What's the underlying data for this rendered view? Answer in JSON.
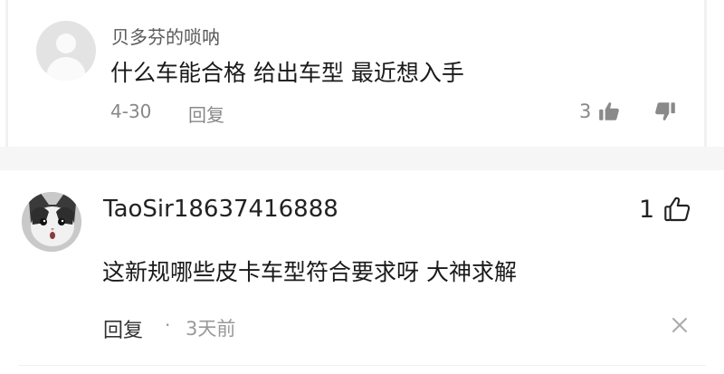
{
  "comments": [
    {
      "username": "贝多芬的唢呐",
      "text": "什么车能合格 给出车型 最近想入手",
      "date": "4-30",
      "reply_label": "回复",
      "likes": "3"
    },
    {
      "username": "TaoSir18637416888",
      "text": "这新规哪些皮卡车型符合要求呀 大神求解",
      "reply_label": "回复",
      "separator": "·",
      "time": "3天前",
      "likes": "1"
    }
  ],
  "icons": {
    "like": "thumbs-up-icon",
    "dislike": "thumbs-down-icon",
    "close": "close-icon",
    "avatar_default": "default-avatar-icon",
    "avatar_cat": "cat-avatar-image"
  },
  "colors": {
    "background": "#ffffff",
    "band": "#f6f6f6",
    "muted_text": "#888888",
    "main_text": "#1a1a1a"
  }
}
